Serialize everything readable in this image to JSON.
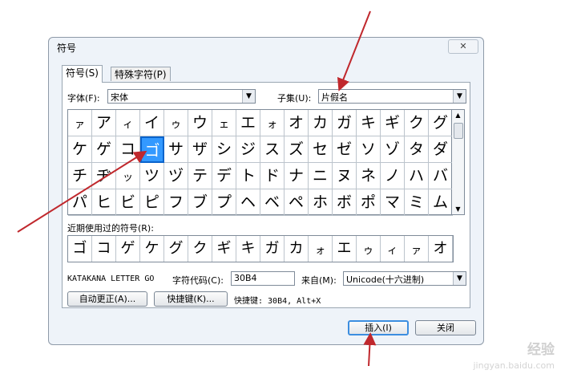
{
  "dialog": {
    "title": "符号",
    "close": "✕",
    "tabs": [
      "符号(S)",
      "特殊字符(P)"
    ],
    "font_label": "字体(F):",
    "font_value": "宋体",
    "subset_label": "子集(U):",
    "subset_value": "片假名",
    "grid": [
      [
        "ァ",
        "ア",
        "ィ",
        "イ",
        "ゥ",
        "ウ",
        "ェ",
        "エ",
        "ォ",
        "オ",
        "カ",
        "ガ",
        "キ",
        "ギ",
        "ク",
        "グ"
      ],
      [
        "ケ",
        "ゲ",
        "コ",
        "ゴ",
        "サ",
        "ザ",
        "シ",
        "ジ",
        "ス",
        "ズ",
        "セ",
        "ゼ",
        "ソ",
        "ゾ",
        "タ",
        "ダ"
      ],
      [
        "チ",
        "ヂ",
        "ッ",
        "ツ",
        "ヅ",
        "テ",
        "デ",
        "ト",
        "ド",
        "ナ",
        "ニ",
        "ヌ",
        "ネ",
        "ノ",
        "ハ",
        "バ"
      ],
      [
        "パ",
        "ヒ",
        "ビ",
        "ピ",
        "フ",
        "ブ",
        "プ",
        "ヘ",
        "ベ",
        "ペ",
        "ホ",
        "ボ",
        "ポ",
        "マ",
        "ミ",
        "ム"
      ]
    ],
    "selected_char": "ゴ",
    "recent_label": "近期使用过的符号(R):",
    "recent": [
      "ゴ",
      "コ",
      "ゲ",
      "ケ",
      "グ",
      "ク",
      "ギ",
      "キ",
      "ガ",
      "カ",
      "ォ",
      "エ",
      "ゥ",
      "ィ",
      "ァ",
      "オ"
    ],
    "char_name": "KATAKANA LETTER GO",
    "code_label": "字符代码(C):",
    "code_value": "30B4",
    "from_label": "来自(M):",
    "from_value": "Unicode(十六进制)",
    "autocorrect_btn": "自动更正(A)...",
    "shortcut_btn": "快捷键(K)...",
    "shortcut_text": "快捷键: 30B4, Alt+X",
    "insert_btn": "插入(I)",
    "close_btn": "关闭"
  },
  "watermark": {
    "line1": "经验",
    "line2": "jingyan.baidu.com"
  },
  "annotation_color": "#c0282d"
}
